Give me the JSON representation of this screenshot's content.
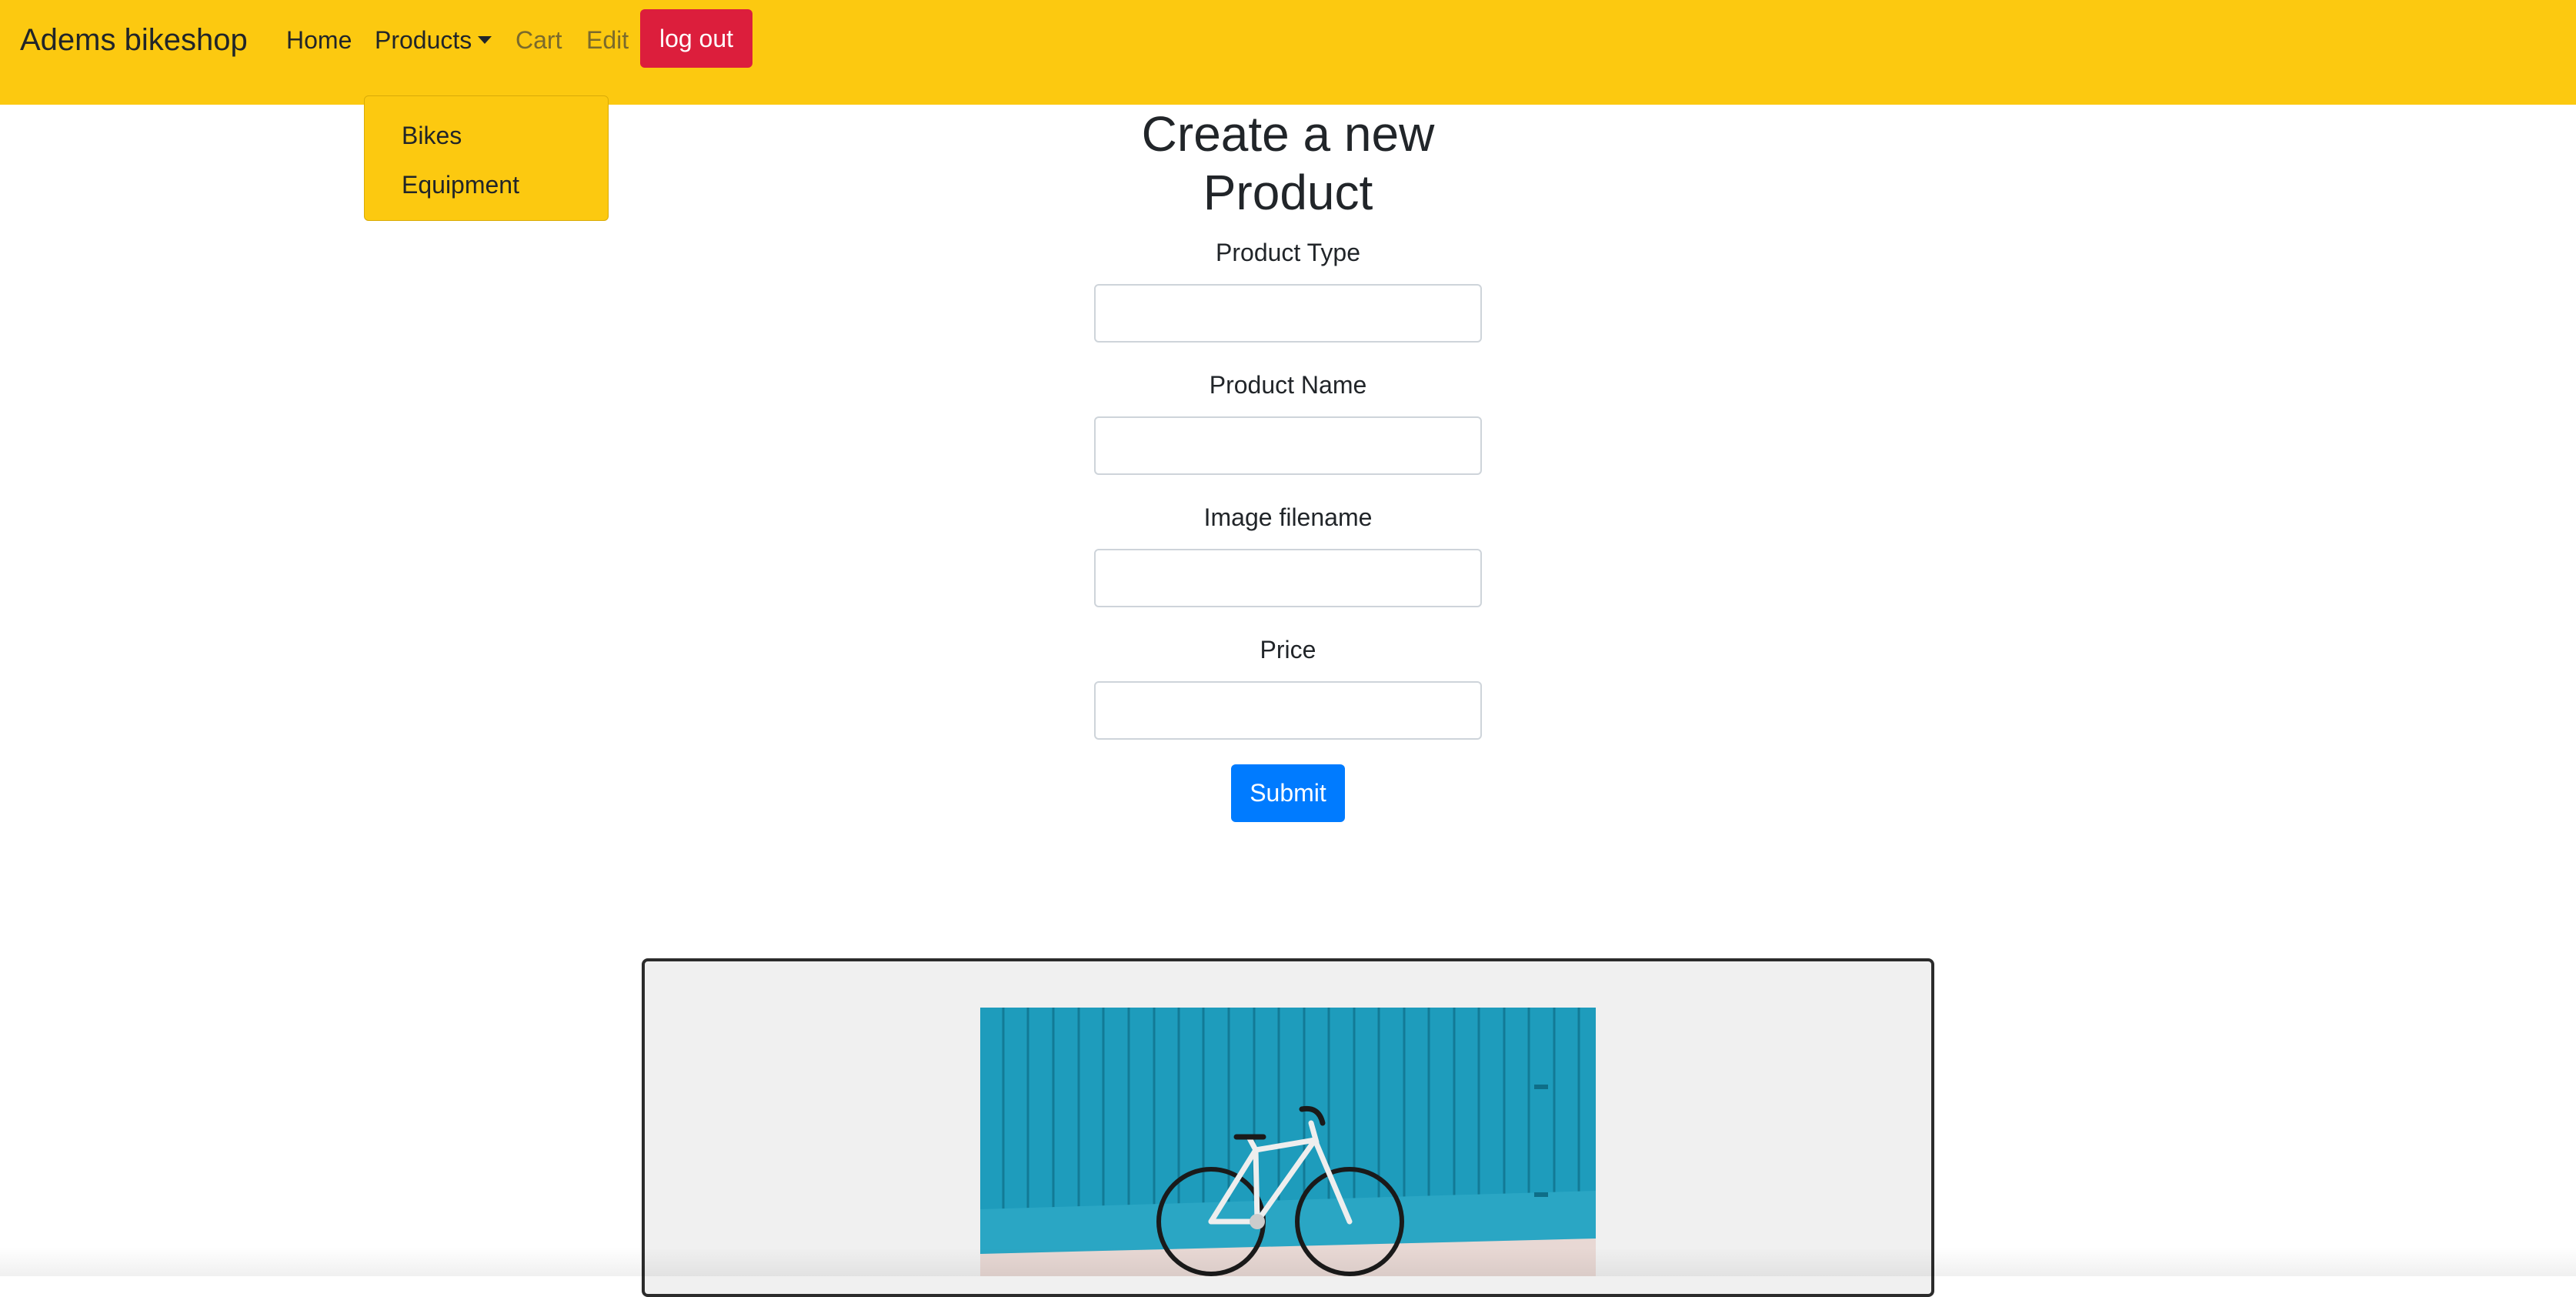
{
  "navbar": {
    "brand": "Adems bikeshop",
    "home_label": "Home",
    "products_label": "Products",
    "cart_label": "Cart",
    "edit_label": "Edit",
    "logout_label": "log out",
    "background_color": "#fcc910",
    "logout_color": "#dc1e3c"
  },
  "products_menu": {
    "items": [
      {
        "label": "Bikes"
      },
      {
        "label": "Equipment"
      }
    ]
  },
  "form": {
    "title": "Create a new Product",
    "fields": [
      {
        "label": "Product Type",
        "value": ""
      },
      {
        "label": "Product Name",
        "value": ""
      },
      {
        "label": "Image filename",
        "value": ""
      },
      {
        "label": "Price",
        "value": ""
      }
    ],
    "submit_label": "Submit",
    "submit_color": "#007bff"
  },
  "product_card": {
    "image_icon": "bicycle-photo"
  }
}
